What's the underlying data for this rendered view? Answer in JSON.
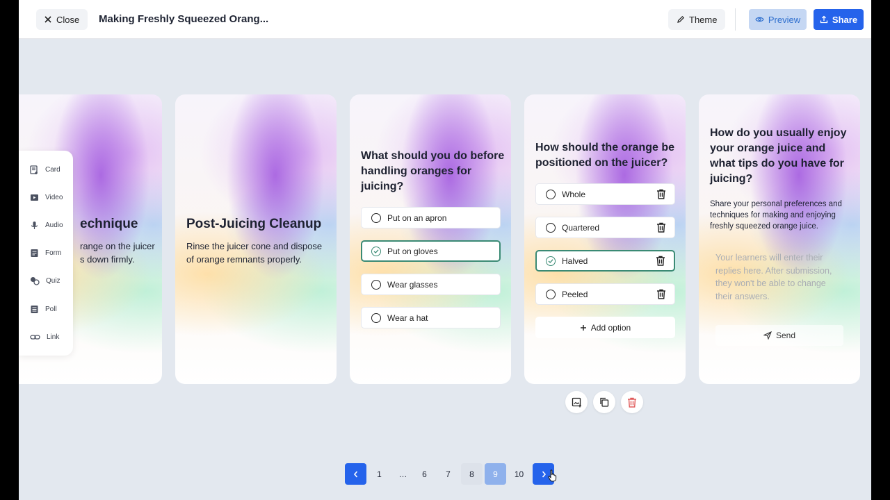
{
  "header": {
    "close_label": "Close",
    "title": "Making Freshly Squeezed Orang...",
    "theme_label": "Theme",
    "preview_label": "Preview",
    "share_label": "Share"
  },
  "palette": {
    "items": [
      {
        "label": "Card",
        "icon": "card-icon"
      },
      {
        "label": "Video",
        "icon": "video-icon"
      },
      {
        "label": "Audio",
        "icon": "microphone-icon"
      },
      {
        "label": "Form",
        "icon": "form-icon"
      },
      {
        "label": "Quiz",
        "icon": "quiz-icon"
      },
      {
        "label": "Poll",
        "icon": "poll-icon"
      },
      {
        "label": "Link",
        "icon": "link-icon"
      }
    ]
  },
  "cards": {
    "technique": {
      "title": "echnique",
      "line1": "range on the juicer",
      "line2": "s down firmly."
    },
    "cleanup": {
      "title": "Post-Juicing Cleanup",
      "line1": "Rinse the juicer cone and dispose",
      "line2": "of orange remnants properly."
    },
    "before": {
      "title_lines": [
        "What should you do before",
        "handling oranges for",
        "juicing?"
      ],
      "options": [
        {
          "label": "Put on an apron",
          "selected": false
        },
        {
          "label": "Put on gloves",
          "selected": true
        },
        {
          "label": "Wear glasses",
          "selected": false
        },
        {
          "label": "Wear a hat",
          "selected": false
        }
      ]
    },
    "position": {
      "title_lines": [
        "How should the orange be",
        "positioned on the juicer?"
      ],
      "options": [
        {
          "label": "Whole",
          "selected": false
        },
        {
          "label": "Quartered",
          "selected": false
        },
        {
          "label": "Halved",
          "selected": true
        },
        {
          "label": "Peeled",
          "selected": false
        }
      ],
      "add_option_label": "Add option"
    },
    "enjoy": {
      "title_lines": [
        "How do you usually enjoy",
        "your orange juice and",
        "what tips do you have for",
        "juicing?"
      ],
      "desc_lines": [
        "Share your personal preferences and",
        "techniques for making and enjoying",
        "freshly squeezed orange juice."
      ],
      "placeholder_lines": [
        "Your learners will enter their",
        "replies here. After submission,",
        "they won't be able to change",
        "their answers."
      ],
      "send_label": "Send"
    }
  },
  "pagination": {
    "pages": [
      "1",
      "…",
      "6",
      "7",
      "8",
      "9",
      "10"
    ],
    "current": "9"
  },
  "colors": {
    "primary": "#2563eb",
    "selected_border": "#3a8a74",
    "delete": "#e05a5a"
  }
}
